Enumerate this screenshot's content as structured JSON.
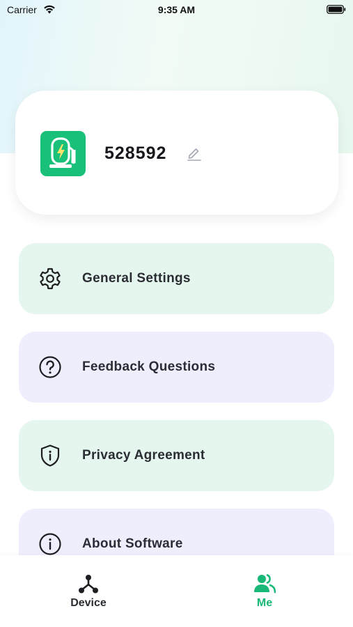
{
  "status_bar": {
    "carrier": "Carrier",
    "time": "9:35 AM"
  },
  "profile": {
    "user_id": "528592",
    "avatar_icon": "charger-icon",
    "edit_icon": "edit-icon"
  },
  "menu": {
    "items": [
      {
        "label": "General Settings",
        "icon": "gear-icon",
        "bg": "#e5f6ee"
      },
      {
        "label": "Feedback Questions",
        "icon": "question-icon",
        "bg": "#efeefd"
      },
      {
        "label": "Privacy Agreement",
        "icon": "shield-icon",
        "bg": "#e5f6ee"
      },
      {
        "label": "About Software",
        "icon": "info-icon",
        "bg": "#efeefd"
      }
    ]
  },
  "tabs": [
    {
      "label": "Device",
      "icon": "device-network-icon",
      "active": false
    },
    {
      "label": "Me",
      "icon": "users-icon",
      "active": true
    }
  ],
  "colors": {
    "accent": "#19c07a",
    "active_tab": "#19b877"
  }
}
